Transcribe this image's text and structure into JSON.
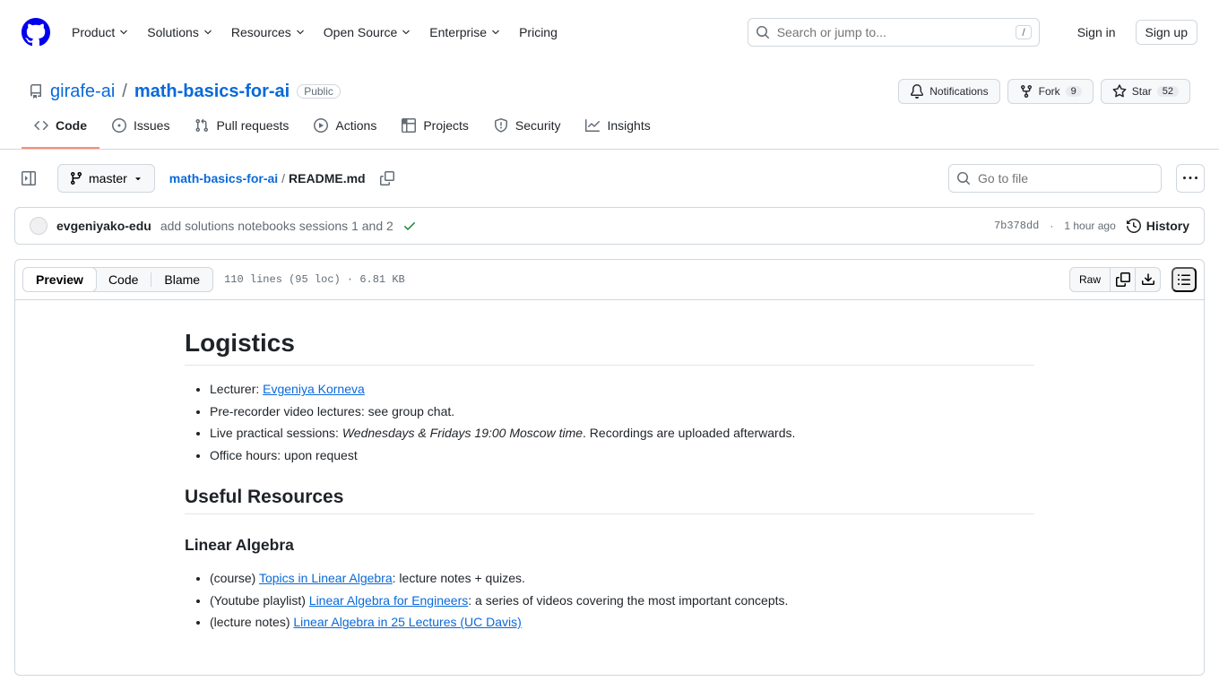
{
  "header": {
    "nav": [
      "Product",
      "Solutions",
      "Resources",
      "Open Source",
      "Enterprise",
      "Pricing"
    ],
    "search_placeholder": "Search or jump to...",
    "slash": "/",
    "sign_in": "Sign in",
    "sign_up": "Sign up"
  },
  "repo": {
    "owner": "girafe-ai",
    "name": "math-basics-for-ai",
    "visibility": "Public",
    "actions": {
      "notifications": "Notifications",
      "fork": "Fork",
      "fork_count": "9",
      "star": "Star",
      "star_count": "52"
    },
    "tabs": [
      "Code",
      "Issues",
      "Pull requests",
      "Actions",
      "Projects",
      "Security",
      "Insights"
    ]
  },
  "file_nav": {
    "branch": "master",
    "breadcrumb_repo": "math-basics-for-ai",
    "breadcrumb_file": "README.md",
    "go_to_placeholder": "Go to file"
  },
  "commit": {
    "author": "evgeniyako-edu",
    "message": "add solutions notebooks sessions 1 and 2",
    "sha": "7b378dd",
    "time": "1 hour ago",
    "history": "History"
  },
  "file_header": {
    "tabs": [
      "Preview",
      "Code",
      "Blame"
    ],
    "meta": "110 lines (95 loc) · 6.81 KB",
    "raw": "Raw"
  },
  "readme": {
    "h1": "Logistics",
    "lecturer_pre": "Lecturer: ",
    "lecturer_link": "Evgeniya Korneva",
    "bullet2": "Pre-recorder video lectures: see group chat.",
    "bullet3_pre": "Live practical sessions: ",
    "bullet3_em": "Wednesdays & Fridays 19:00 Moscow time",
    "bullet3_post": ". Recordings are uploaded afterwards.",
    "bullet4": "Office hours: upon request",
    "h2": "Useful Resources",
    "h3": "Linear Algebra",
    "r1_pre": "(course) ",
    "r1_link": "Topics in Linear Algebra",
    "r1_post": ": lecture notes + quizes.",
    "r2_pre": "(Youtube playlist) ",
    "r2_link": "Linear Algebra for Engineers",
    "r2_post": ": a series of videos covering the most important concepts.",
    "r3_pre": "(lecture notes) ",
    "r3_link": "Linear Algebra in 25 Lectures (UC Davis)"
  }
}
